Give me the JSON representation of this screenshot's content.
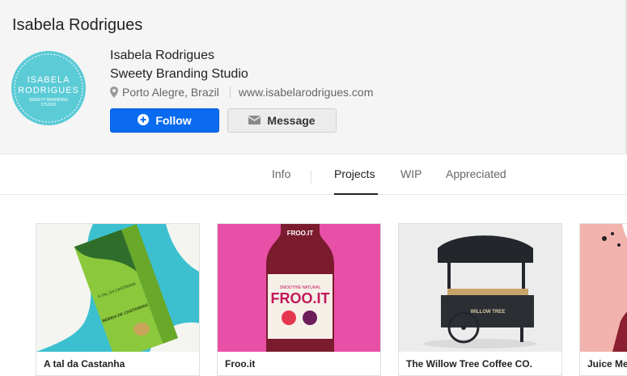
{
  "header": {
    "title": "Isabela Rodrigues"
  },
  "avatar": {
    "line1": "ISABELA",
    "line2": "RODRIGUES",
    "line3": "SWEETY BRANDING",
    "line4": "STUDIO",
    "color": "#5bcbd6"
  },
  "profile": {
    "name": "Isabela Rodrigues",
    "company": "Sweety Branding Studio",
    "location": "Porto Alegre, Brazil",
    "website": "www.isabelarodrigues.com"
  },
  "buttons": {
    "follow_label": "Follow",
    "message_label": "Message"
  },
  "tabs": [
    {
      "label": "Info"
    },
    {
      "label": "Projects",
      "active": true
    },
    {
      "label": "WIP"
    },
    {
      "label": "Appreciated"
    }
  ],
  "projects": [
    {
      "title": "A tal da Castanha",
      "product_text": "BEBIDA DE CASTANHAS",
      "brand_text": "A TAL DA CASTANHA"
    },
    {
      "title": "Froo.it",
      "product_text": "FROO.IT",
      "tagline": "SMOOTHIE NATURAL"
    },
    {
      "title": "The Willow Tree Coffee CO.",
      "product_text": "WILLOW TREE"
    },
    {
      "title": "Juice Me"
    }
  ],
  "colors": {
    "accent": "#0a6bf0",
    "header_bg": "#f5f5f5"
  }
}
